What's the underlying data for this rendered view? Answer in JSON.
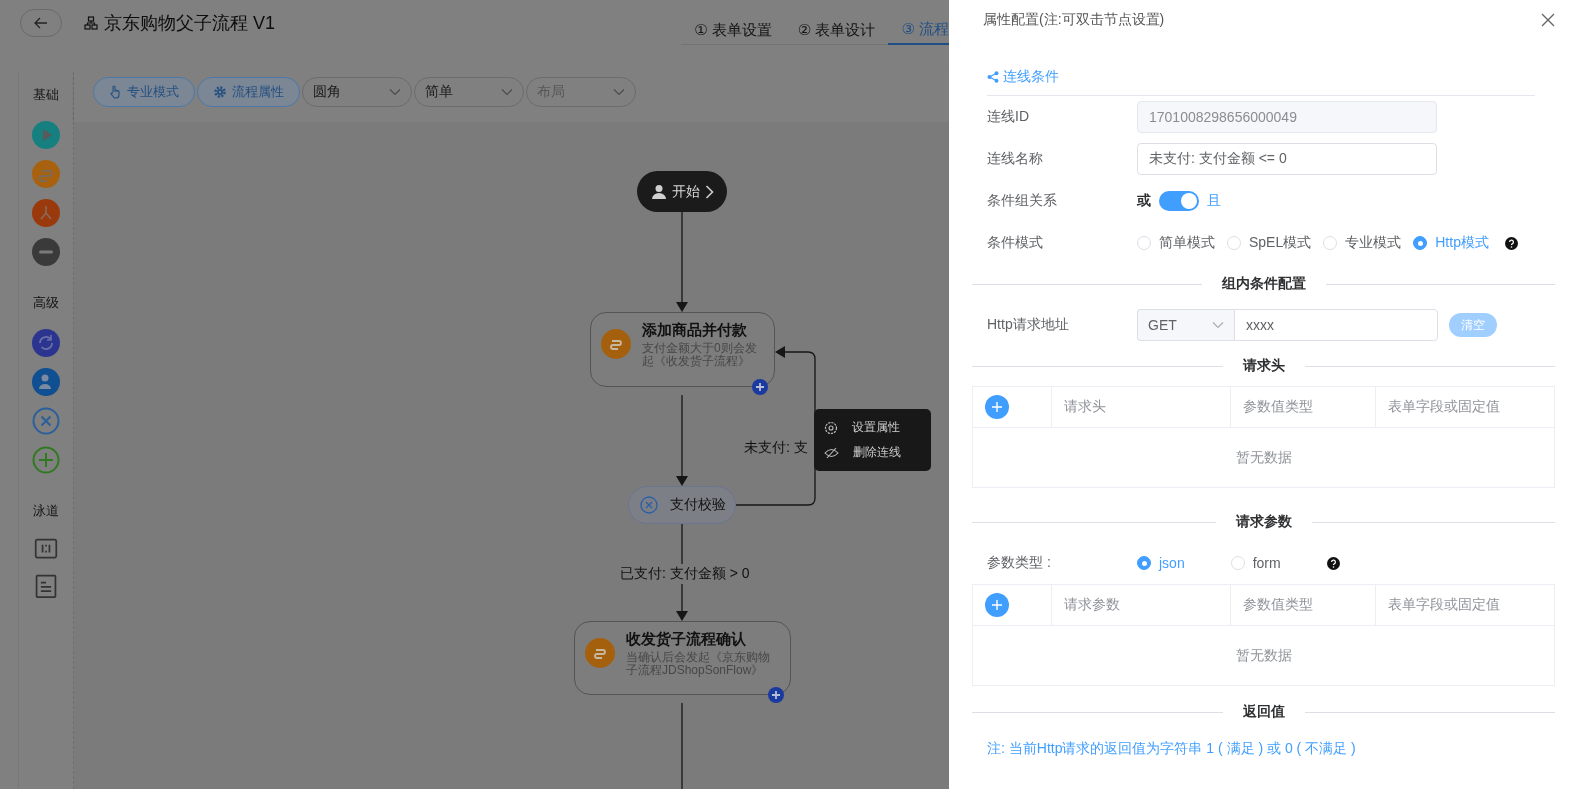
{
  "header": {
    "title": "京东购物父子流程 V1",
    "steps": [
      {
        "label": "① 表单设置",
        "selected": false
      },
      {
        "label": "② 表单设计",
        "selected": false
      },
      {
        "label": "③ 流程",
        "selected": true
      }
    ]
  },
  "palette": {
    "groups": [
      {
        "label": "基础",
        "items": [
          {
            "kind": "start"
          },
          {
            "kind": "subflow"
          },
          {
            "kind": "branch"
          },
          {
            "kind": "end"
          }
        ]
      },
      {
        "label": "高级",
        "items": [
          {
            "kind": "loop"
          },
          {
            "kind": "user"
          },
          {
            "kind": "cancel"
          },
          {
            "kind": "add"
          }
        ]
      },
      {
        "label": "泳道",
        "items": [
          {
            "kind": "lane_columns"
          },
          {
            "kind": "lane_rows"
          }
        ]
      }
    ]
  },
  "toolbar": {
    "buttons": [
      {
        "label": "专业模式",
        "kind": "hand"
      },
      {
        "label": "流程属性",
        "kind": "gear"
      }
    ],
    "selects": [
      {
        "value": "圆角"
      },
      {
        "value": "简单"
      },
      {
        "placeholder": "布局"
      }
    ]
  },
  "canvas": {
    "nodes": [
      {
        "kind": "start",
        "title": "开始"
      },
      {
        "kind": "task",
        "title": "添加商品并付款",
        "description": "支付金额大于0则会发起《收发货子流程》"
      },
      {
        "kind": "gateway",
        "title": "支付校验"
      },
      {
        "kind": "task",
        "title": "收发货子流程确认",
        "description": "当确认后会发起《京东购物子流程JDShopSonFlow》"
      }
    ],
    "edge_labels": [
      "未支付: 支",
      "已支付: 支付金额 > 0"
    ],
    "context_menu": [
      {
        "label": "设置属性",
        "kind": "gear"
      },
      {
        "label": "删除连线",
        "kind": "hide"
      }
    ]
  },
  "drawer": {
    "title": "属性配置(注:可双击节点设置)",
    "section": "连线条件",
    "fields": [
      {
        "label": "连线ID",
        "value": "1701008298656000049",
        "disabled": true
      },
      {
        "label": "连线名称",
        "value": "未支付: 支付金额 <= 0",
        "disabled": false
      }
    ],
    "relation": {
      "label": "条件组关系",
      "off_label": "或",
      "on_label": "且",
      "on": true
    },
    "mode": {
      "label": "条件模式",
      "options": [
        {
          "label": "简单模式",
          "selected": false
        },
        {
          "label": "SpEL模式",
          "selected": false
        },
        {
          "label": "专业模式",
          "selected": false
        },
        {
          "label": "Http模式",
          "selected": true
        }
      ]
    },
    "group_title": "组内条件配置",
    "http": {
      "label": "Http请求地址",
      "method": "GET",
      "url": "xxxx",
      "clear_button": "清空"
    },
    "headers": {
      "title": "请求头",
      "columns": [
        "请求头",
        "参数值类型",
        "表单字段或固定值"
      ],
      "empty": "暂无数据"
    },
    "params": {
      "title": "请求参数",
      "type_label": "参数类型 :",
      "types": [
        {
          "label": "json",
          "selected": true
        },
        {
          "label": "form",
          "selected": false
        }
      ],
      "columns": [
        "请求参数",
        "参数值类型",
        "表单字段或固定值"
      ],
      "empty": "暂无数据"
    },
    "return": {
      "title": "返回值",
      "note": "注: 当前Http请求的返回值为字符串 1 ( 满足 ) 或 0 ( 不满足 )"
    }
  }
}
